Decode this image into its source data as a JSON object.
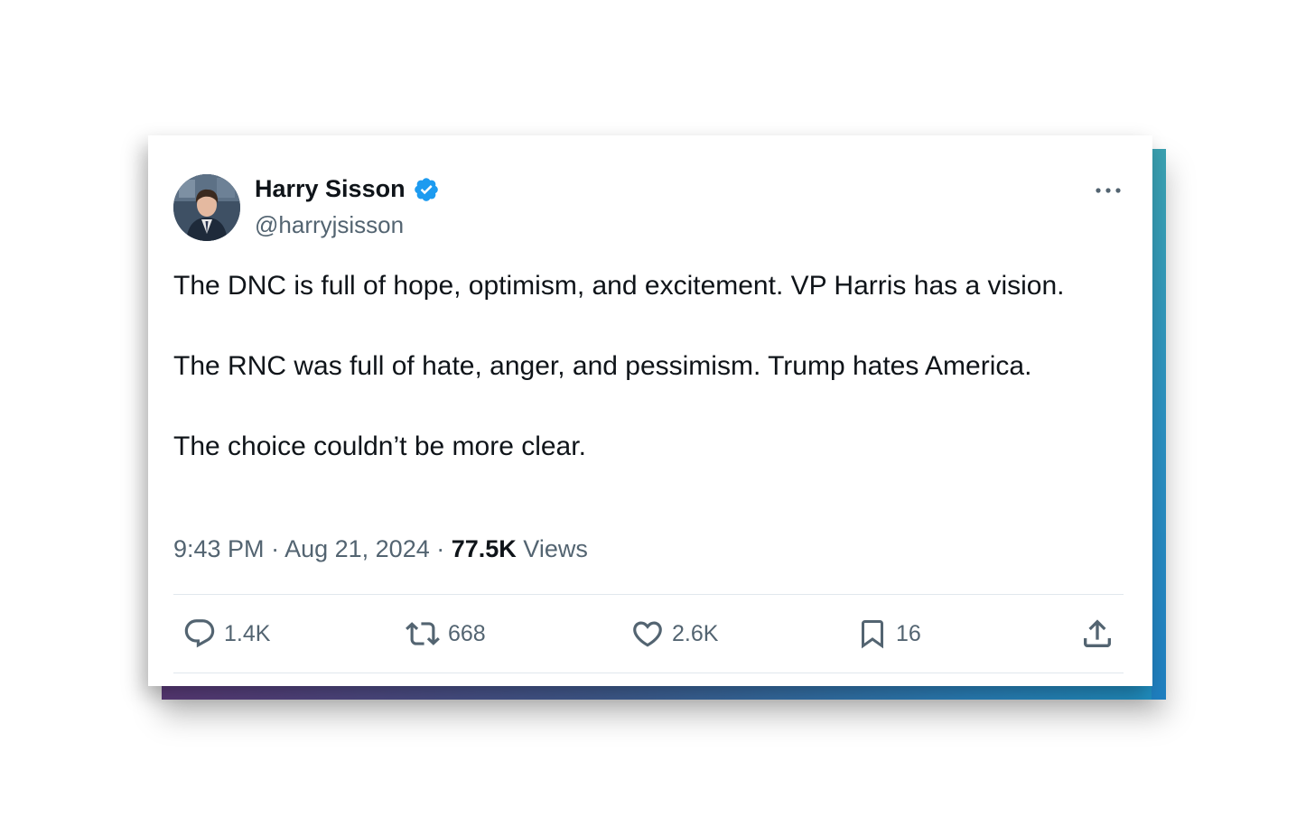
{
  "author": {
    "display_name": "Harry Sisson",
    "handle": "@harryjsisson",
    "verified": true
  },
  "tweet": {
    "paragraph_1": "The DNC is full of hope, optimism, and excitement. VP Harris has a vision.",
    "paragraph_2": "The RNC was full of hate, anger, and pessimism. Trump hates America.",
    "paragraph_3": "The choice couldn’t be more clear."
  },
  "meta": {
    "time": "9:43 PM",
    "sep1": " · ",
    "date": "Aug 21, 2024",
    "sep2": " · ",
    "views_count": "77.5K",
    "views_label": " Views"
  },
  "actions": {
    "replies": "1.4K",
    "reposts": "668",
    "likes": "2.6K",
    "bookmarks": "16"
  },
  "icons": {
    "verified": "verified-badge-icon",
    "more": "more-dots-icon",
    "reply": "reply-icon",
    "repost": "repost-icon",
    "like": "heart-icon",
    "bookmark": "bookmark-icon",
    "share": "share-icon"
  },
  "colors": {
    "verified_blue": "#1d9bf0",
    "text_primary": "#0f1419",
    "text_secondary": "#536471"
  }
}
